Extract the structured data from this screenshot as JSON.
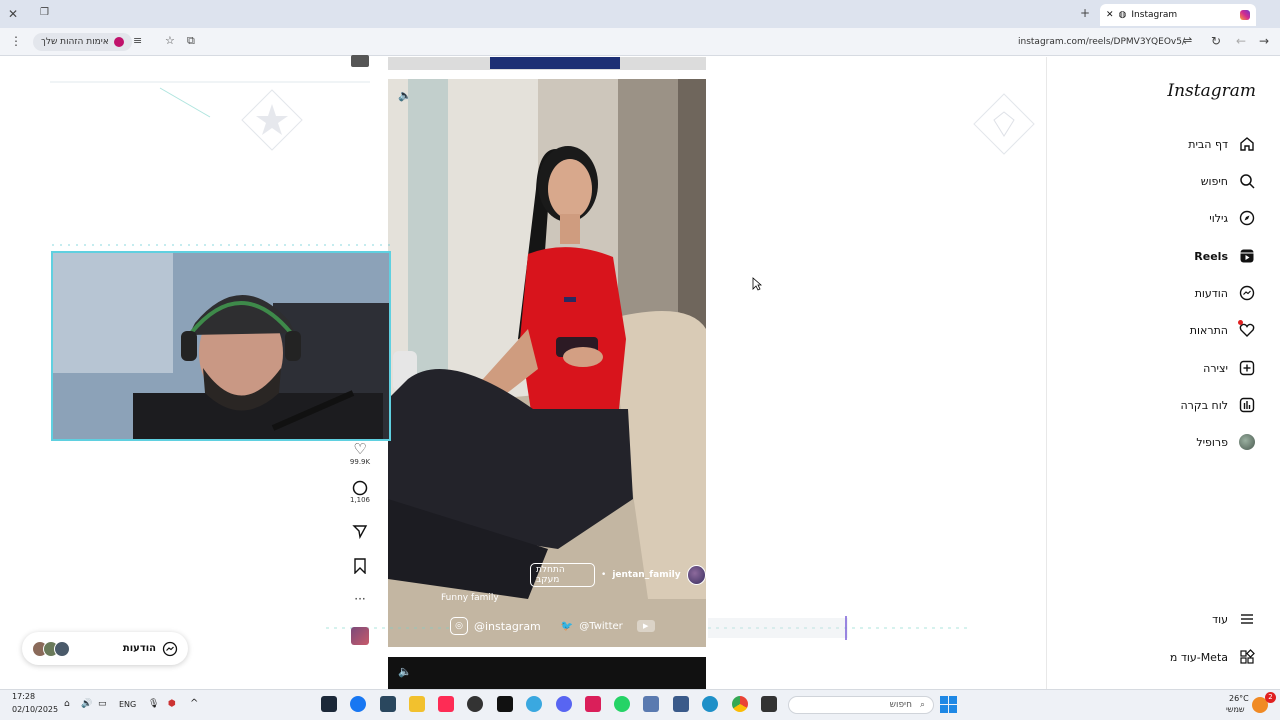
{
  "browser": {
    "tab_title": "Instagram",
    "url": "instagram.com/reels/DPMV3YQEOv5/",
    "pill_label": "אימות הזהות שלך"
  },
  "sidebar": {
    "logo": "Instagram",
    "items": [
      {
        "label": "דף הבית",
        "icon": "home-icon"
      },
      {
        "label": "חיפוש",
        "icon": "search-icon"
      },
      {
        "label": "גילוי",
        "icon": "compass-icon"
      },
      {
        "label": "Reels",
        "icon": "reels-icon"
      },
      {
        "label": "הודעות",
        "icon": "messenger-icon"
      },
      {
        "label": "התראות",
        "icon": "heart-icon"
      },
      {
        "label": "יצירה",
        "icon": "plus-square-icon"
      },
      {
        "label": "לוח בקרה",
        "icon": "dashboard-icon"
      },
      {
        "label": "פרופיל",
        "icon": "avatar-icon"
      }
    ],
    "more": "עוד",
    "meta": "עוד מ-Meta"
  },
  "reel": {
    "username": "jentan_family",
    "follow_label": "התחלת מעקב",
    "caption": "Funny family",
    "overlay_handle": "@instagram",
    "overlay_twitter": "@Twitter"
  },
  "actions": {
    "likes": "99.9K",
    "comments": "1,106"
  },
  "messages_pill": {
    "label": "הודעות"
  },
  "taskbar": {
    "time": "17:28",
    "date": "02/10/2025",
    "lang": "ENG",
    "search_placeholder": "חיפוש",
    "temp": "26°C",
    "weather": "שמשי",
    "notif_count": "2"
  },
  "colors": {
    "accent_red": "#e02020",
    "webcam_border": "#5fd0e0",
    "reel_shirt": "#d8141c"
  }
}
